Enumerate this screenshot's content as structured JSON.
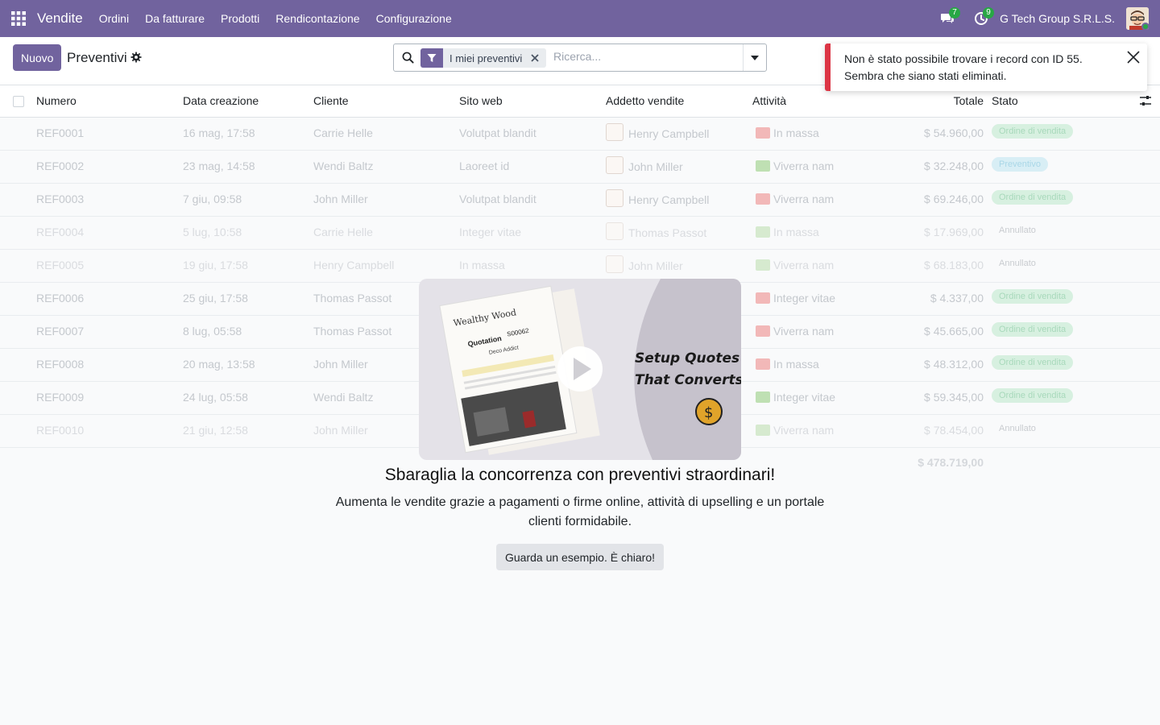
{
  "navbar": {
    "app_name": "Vendite",
    "menu": [
      "Ordini",
      "Da fatturare",
      "Prodotti",
      "Rendicontazione",
      "Configurazione"
    ],
    "messages_count": "7",
    "activities_count": "9",
    "company": "G Tech Group S.R.L.S.",
    "color": "#71639e"
  },
  "control_panel": {
    "new_button": "Nuovo",
    "title": "Preventivi",
    "search": {
      "facet": "I miei preventivi",
      "placeholder": "Ricerca..."
    }
  },
  "table": {
    "headers": {
      "numero": "Numero",
      "data": "Data creazione",
      "cliente": "Cliente",
      "sito": "Sito web",
      "addetto": "Addetto vendite",
      "attivita": "Attività",
      "totale": "Totale",
      "stato": "Stato"
    },
    "rows": [
      {
        "numero": "REF0001",
        "data": "16 mag, 17:58",
        "cliente": "Carrie Helle",
        "sito": "Volutpat blandit",
        "addetto": "Henry Campbell",
        "attivita": "In massa",
        "act_color": "#f2b8b8",
        "totale": "$ 54.960,00",
        "stato": "Ordine di vendita",
        "stato_kind": "sale"
      },
      {
        "numero": "REF0002",
        "data": "23 mag, 14:58",
        "cliente": "Wendi Baltz",
        "sito": "Laoreet id",
        "addetto": "John Miller",
        "attivita": "Viverra nam",
        "act_color": "#bfe0b3",
        "totale": "$ 32.248,00",
        "stato": "Preventivo",
        "stato_kind": "draft"
      },
      {
        "numero": "REF0003",
        "data": "7 giu, 09:58",
        "cliente": "John Miller",
        "sito": "Volutpat blandit",
        "addetto": "Henry Campbell",
        "attivita": "Viverra nam",
        "act_color": "#f2b8b8",
        "totale": "$ 69.246,00",
        "stato": "Ordine di vendita",
        "stato_kind": "sale"
      },
      {
        "numero": "REF0004",
        "data": "5 lug, 10:58",
        "cliente": "Carrie Helle",
        "sito": "Integer vitae",
        "addetto": "Thomas Passot",
        "attivita": "In massa",
        "act_color": "#bfe0b3",
        "totale": "$ 17.969,00",
        "stato": "Annullato",
        "stato_kind": "cancel"
      },
      {
        "numero": "REF0005",
        "data": "19 giu, 17:58",
        "cliente": "Henry Campbell",
        "sito": "In massa",
        "addetto": "John Miller",
        "attivita": "Viverra nam",
        "act_color": "#bfe0b3",
        "totale": "$ 68.183,00",
        "stato": "Annullato",
        "stato_kind": "cancel"
      },
      {
        "numero": "REF0006",
        "data": "25 giu, 17:58",
        "cliente": "Thomas Passot",
        "sito": "",
        "addetto": "",
        "attivita": "Integer vitae",
        "act_color": "#f2b8b8",
        "totale": "$ 4.337,00",
        "stato": "Ordine di vendita",
        "stato_kind": "sale"
      },
      {
        "numero": "REF0007",
        "data": "8 lug, 05:58",
        "cliente": "Thomas Passot",
        "sito": "",
        "addetto": "",
        "attivita": "Viverra nam",
        "act_color": "#f2b8b8",
        "totale": "$ 45.665,00",
        "stato": "Ordine di vendita",
        "stato_kind": "sale"
      },
      {
        "numero": "REF0008",
        "data": "20 mag, 13:58",
        "cliente": "John Miller",
        "sito": "",
        "addetto": "",
        "attivita": "In massa",
        "act_color": "#f2b8b8",
        "totale": "$ 48.312,00",
        "stato": "Ordine di vendita",
        "stato_kind": "sale"
      },
      {
        "numero": "REF0009",
        "data": "24 lug, 05:58",
        "cliente": "Wendi Baltz",
        "sito": "",
        "addetto": "",
        "attivita": "Integer vitae",
        "act_color": "#bfe0b3",
        "totale": "$ 59.345,00",
        "stato": "Ordine di vendita",
        "stato_kind": "sale"
      },
      {
        "numero": "REF0010",
        "data": "21 giu, 12:58",
        "cliente": "John Miller",
        "sito": "",
        "addetto": "",
        "attivita": "Viverra nam",
        "act_color": "#bfe0b3",
        "totale": "$ 78.454,00",
        "stato": "Annullato",
        "stato_kind": "cancel"
      }
    ],
    "grand_total": "$ 478.719,00"
  },
  "help": {
    "image_title_line1": "Setup Quotes",
    "image_title_line2": "That Converts",
    "doc_brand": "Wealthy Wood",
    "doc_label": "Quotation",
    "doc_number": "S00062",
    "doc_customer": "Deco Addict",
    "title": "Sbaraglia la concorrenza con preventivi straordinari!",
    "description": "Aumenta le vendite grazie a pagamenti o firme online, attività di upselling e un portale clienti formidabile.",
    "button": "Guarda un esempio. È chiaro!"
  },
  "notification": {
    "message": "Non è stato possibile trovare i record con ID 55. Sembra che siano stati eliminati."
  }
}
